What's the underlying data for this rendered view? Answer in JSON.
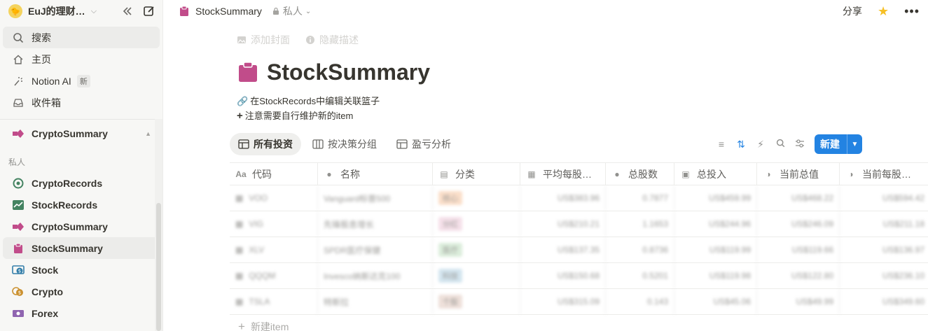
{
  "workspace": {
    "name": "EuJ的理财…",
    "avatar": "🐤"
  },
  "sidebar": {
    "search": "搜索",
    "home": "主页",
    "notion_ai": "Notion AI",
    "notion_ai_badge": "新",
    "inbox": "收件箱",
    "favorite": "CryptoSummary",
    "private_label": "私人",
    "pages": [
      {
        "label": "CryptoRecords",
        "icon": "target-icon",
        "color": "#448361"
      },
      {
        "label": "StockRecords",
        "icon": "chart-line-icon",
        "color": "#448361"
      },
      {
        "label": "CryptoSummary",
        "icon": "arrows-icon",
        "color": "#c14c8a"
      },
      {
        "label": "StockSummary",
        "icon": "clipboard-icon",
        "color": "#c14c8a"
      },
      {
        "label": "Stock",
        "icon": "currency-exchange-icon",
        "color": "#337ea9"
      },
      {
        "label": "Crypto",
        "icon": "coins-icon",
        "color": "#cb912f"
      },
      {
        "label": "Forex",
        "icon": "cash-icon",
        "color": "#9065b0"
      }
    ]
  },
  "topbar": {
    "breadcrumb": "StockSummary",
    "privacy": "私人",
    "share": "分享"
  },
  "page": {
    "add_cover": "添加封面",
    "hide_description": "隐藏描述",
    "title": "StockSummary",
    "desc_line1": "在StockRecords中编辑关联篮子",
    "desc_line2": "注意需要自行维护新的item"
  },
  "views": {
    "tabs": [
      "所有投资",
      "按决策分组",
      "盈亏分析"
    ],
    "new_button": "新建"
  },
  "table": {
    "columns": [
      "代码",
      "名称",
      "分类",
      "平均每股…",
      "总股数",
      "总投入",
      "当前总值",
      "当前每股…"
    ],
    "rows": [
      {
        "code": "VOO",
        "name": "Vanguard标普500",
        "cat": "核心",
        "cat_color": "#fadec9",
        "avg": "US$383.96",
        "shares": "0.7877",
        "invest": "US$459.99",
        "value": "US$468.22",
        "cur": "US$594.42"
      },
      {
        "code": "VIG",
        "name": "先锋股息增长",
        "cat": "分红",
        "cat_color": "#f5e0e9",
        "avg": "US$210.21",
        "shares": "1.1653",
        "invest": "US$244.96",
        "value": "US$246.09",
        "cur": "US$211.18"
      },
      {
        "code": "XLV",
        "name": "SPDR医疗保健",
        "cat": "医疗",
        "cat_color": "#dbeddb",
        "avg": "US$137.35",
        "shares": "0.8736",
        "invest": "US$119.99",
        "value": "US$119.66",
        "cur": "US$136.97"
      },
      {
        "code": "QQQM",
        "name": "Invesco纳斯达克100",
        "cat": "科技",
        "cat_color": "#d3e5ef",
        "avg": "US$150.68",
        "shares": "0.5201",
        "invest": "US$119.98",
        "value": "US$122.80",
        "cur": "US$236.10"
      },
      {
        "code": "TSLA",
        "name": "特斯拉",
        "cat": "个股",
        "cat_color": "#eee0da",
        "avg": "US$315.09",
        "shares": "0.143",
        "invest": "US$45.06",
        "value": "US$49.99",
        "cur": "US$349.60"
      }
    ],
    "add_item": "新建item"
  }
}
